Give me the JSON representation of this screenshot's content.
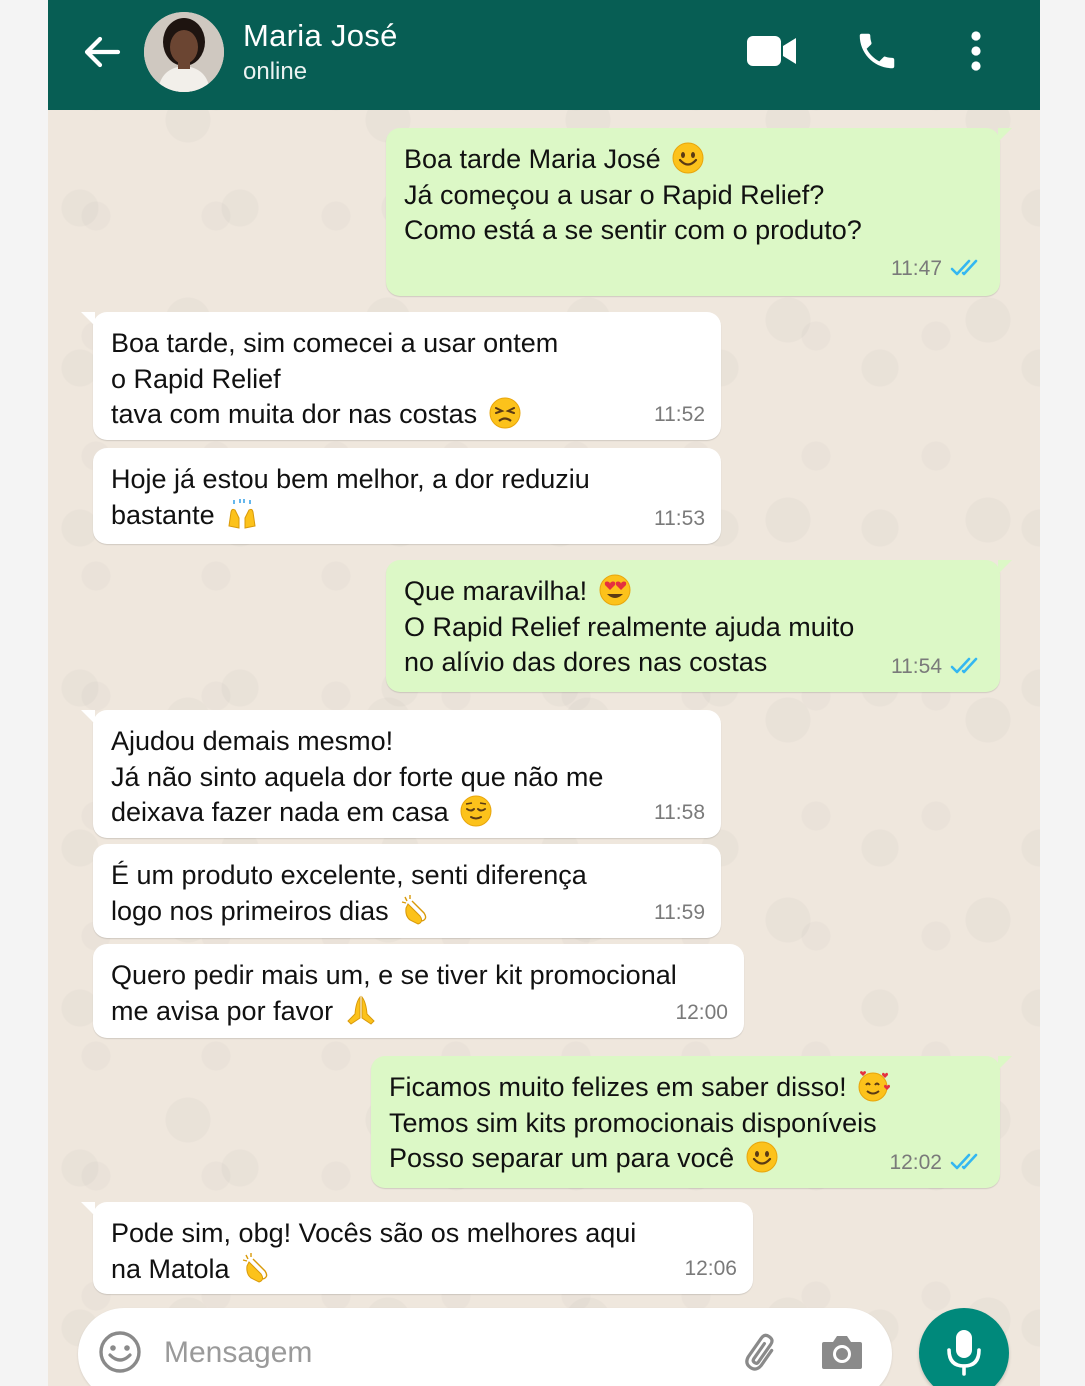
{
  "header": {
    "contact_name": "Maria José",
    "status": "online",
    "icons": [
      "back-arrow-icon",
      "video-call-icon",
      "voice-call-icon",
      "more-options-icon"
    ],
    "color": "#075e54"
  },
  "messages": [
    {
      "direction": "out",
      "lines": [
        "Boa tarde Maria José",
        "Já começou a usar o Rapid Relief?",
        "Como está a se sentir com o produto?"
      ],
      "emoji": "😊",
      "time": "11:47",
      "read": true
    },
    {
      "direction": "in",
      "lines": [
        "Boa tarde, sim comecei a usar ontem",
        "o Rapid Relief",
        "tava com muita dor nas costas"
      ],
      "emoji": "😣",
      "time": "11:52"
    },
    {
      "direction": "in",
      "lines": [
        "Hoje já estou bem melhor, a dor reduziu",
        "bastante"
      ],
      "emoji": "🙌",
      "time": "11:53"
    },
    {
      "direction": "out",
      "lines": [
        "Que maravilha!",
        "O Rapid Relief realmente ajuda muito",
        "no alívio das dores nas costas"
      ],
      "emoji": "😍",
      "time": "11:54",
      "read": true
    },
    {
      "direction": "in",
      "lines": [
        "Ajudou demais mesmo!",
        "Já não sinto aquela dor forte que não me",
        "deixava fazer nada em casa"
      ],
      "emoji": "😌",
      "time": "11:58"
    },
    {
      "direction": "in",
      "lines": [
        "É um produto excelente, senti diferença",
        "logo nos primeiros dias"
      ],
      "emoji": "👏",
      "time": "11:59"
    },
    {
      "direction": "in",
      "lines": [
        "Quero pedir mais um, e se tiver kit promocional",
        "me avisa por favor"
      ],
      "emoji": "🙏",
      "time": "12:00"
    },
    {
      "direction": "out",
      "lines": [
        "Ficamos muito felizes em saber disso!",
        "Temos sim kits promocionais disponíveis",
        "Posso separar um para você"
      ],
      "emoji": "🥰",
      "emoji2": "😊",
      "time": "12:02",
      "read": true
    },
    {
      "direction": "in",
      "lines": [
        "Pode sim, obg! Vocês são os melhores aqui",
        "na Matola"
      ],
      "emoji": "👏",
      "time": "12:06"
    }
  ],
  "input": {
    "placeholder": "Mensagem",
    "icons": [
      "emoji-icon",
      "attach-icon",
      "camera-icon",
      "mic-icon"
    ]
  },
  "colors": {
    "incoming": "#ffffff",
    "outgoing": "#dcf8c6",
    "read_ticks": "#34b7f1",
    "mic": "#00897b"
  }
}
